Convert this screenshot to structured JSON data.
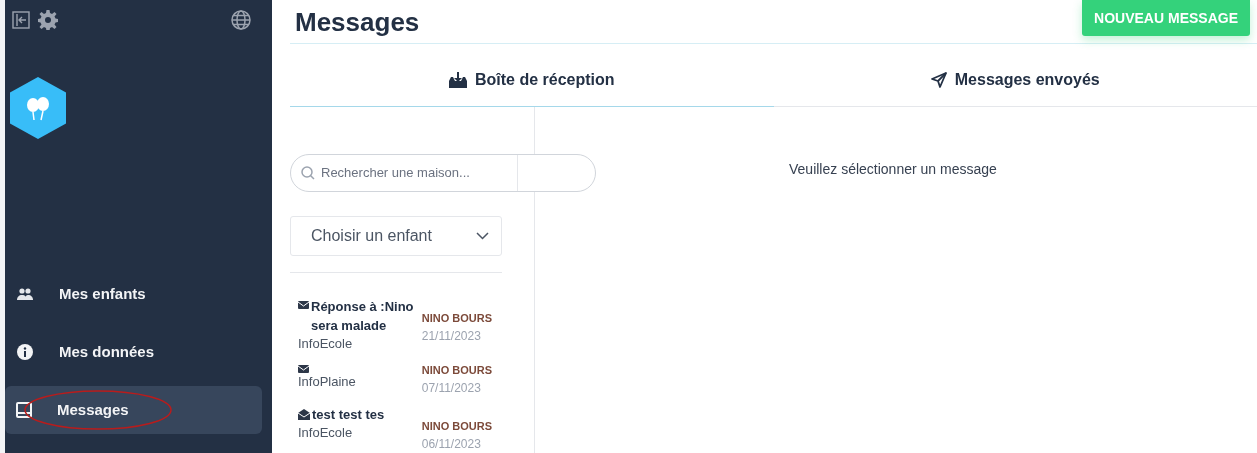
{
  "sidebar": {
    "items": [
      {
        "label": "Mes enfants",
        "kind": "users",
        "selected": false
      },
      {
        "label": "Mes données",
        "kind": "info",
        "selected": false
      },
      {
        "label": "Messages",
        "kind": "inbox",
        "selected": true
      }
    ]
  },
  "page": {
    "title": "Messages",
    "new_button": "NOUVEAU MESSAGE"
  },
  "tabs": [
    {
      "label": "Boîte de réception",
      "kind": "inbox",
      "selected": true
    },
    {
      "label": "Messages envoyés",
      "kind": "send",
      "selected": false
    }
  ],
  "search": {
    "placeholder": "Rechercher une maison..."
  },
  "child_select": {
    "value": "Choisir un enfant"
  },
  "messages": [
    {
      "kind": "closed",
      "subject": "Réponse à :Nino sera malade",
      "sender": "InfoEcole",
      "child": "NINO BOURS",
      "date": "21/11/2023"
    },
    {
      "kind": "closed",
      "sender": "InfoPlaine",
      "child": "NINO BOURS",
      "date": "07/11/2023"
    },
    {
      "kind": "open",
      "subject": "test test tes",
      "sender": "InfoEcole",
      "child": "NINO BOURS",
      "date": "06/11/2023"
    }
  ],
  "detail": {
    "empty_text": "Veuillez sélectionner un message"
  }
}
